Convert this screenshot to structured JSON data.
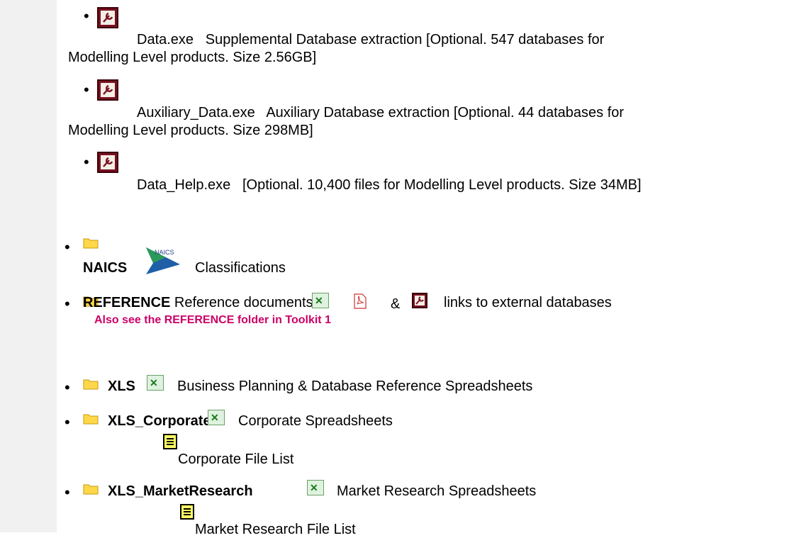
{
  "sub_items": [
    {
      "name": "Data.exe",
      "desc": "Supplemental Database extraction [Optional. 547 databases for",
      "desc2": "Modelling Level products. Size 2.56GB]"
    },
    {
      "name": "Auxiliary_Data.exe",
      "desc": "Auxiliary Database extraction [Optional. 44 databases for",
      "desc2": "Modelling Level products. Size 298MB]"
    },
    {
      "name": "Data_Help.exe",
      "desc": "[Optional. 10,400 files for Modelling Level products. Size 34MB]"
    }
  ],
  "folders": {
    "naics": {
      "name": "NAICS",
      "desc": "Classifications",
      "logo_text": "NAICS"
    },
    "reference": {
      "name": "REFERENCE",
      "desc": "Reference documents:",
      "amp": "&",
      "desc2": "links to external databases",
      "note": "Also see the REFERENCE folder in Toolkit 1"
    },
    "xls": {
      "name": "XLS",
      "desc": "Business Planning & Database Reference Spreadsheets"
    },
    "xls_corporate": {
      "name": "XLS_Corporate",
      "desc": "Corporate Spreadsheets",
      "list": "Corporate File List"
    },
    "xls_market": {
      "name": "XLS_MarketResearch",
      "desc": "Market Research Spreadsheets",
      "list": "Market Research File List"
    }
  },
  "colors": {
    "note": "#cc0066",
    "folder": "#ffd84a",
    "access": "#7a1020"
  }
}
